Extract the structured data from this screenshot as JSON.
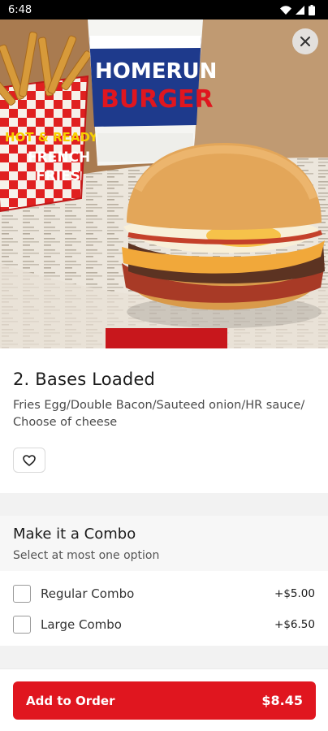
{
  "status_bar": {
    "time": "6:48"
  },
  "hero": {
    "cup_text_top": "HOMERUN",
    "cup_text_bottom": "BURGER",
    "fries_text_1": "HOT & READY",
    "fries_text_2": "FRENCH",
    "fries_text_3": "FRIES"
  },
  "item": {
    "title": "2. Bases Loaded",
    "description": "Fries Egg/Double Bacon/Sauteed onion/HR sauce/ Choose of cheese"
  },
  "combo": {
    "title": "Make it a Combo",
    "subtitle": "Select at most one option",
    "options": [
      {
        "label": "Regular Combo",
        "price": "+$5.00"
      },
      {
        "label": "Large Combo",
        "price": "+$6.50"
      }
    ]
  },
  "footer": {
    "button_label": "Add to Order",
    "total": "$8.45"
  },
  "colors": {
    "accent": "#e0161f"
  }
}
